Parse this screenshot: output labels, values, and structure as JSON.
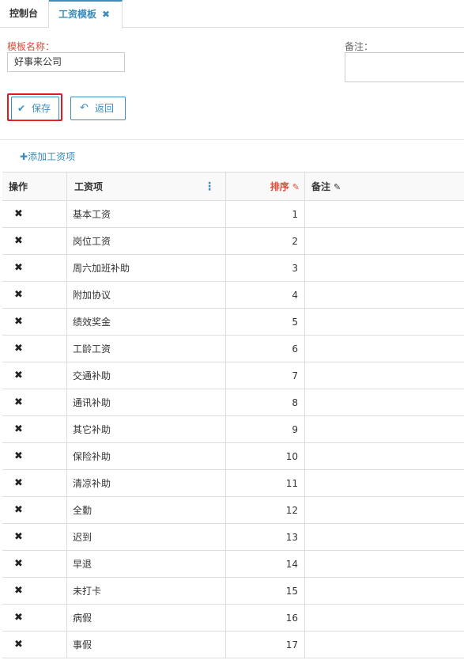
{
  "tabs": [
    {
      "label": "控制台"
    },
    {
      "label": "工资模板",
      "close": "✖"
    }
  ],
  "form": {
    "name_label": "模板名称：",
    "name_value": "好事来公司",
    "remark_label": "备注：",
    "remark_value": ""
  },
  "buttons": {
    "save_label": "保存",
    "back_label": "返回"
  },
  "add_link": {
    "plus": "✚",
    "label": "添加工资项"
  },
  "table": {
    "headers": {
      "op": "操作",
      "item": "工资项",
      "order": "排序",
      "remark": "备注"
    },
    "rows": [
      {
        "name": "基本工资",
        "order": "1"
      },
      {
        "name": "岗位工资",
        "order": "2"
      },
      {
        "name": "周六加班补助",
        "order": "3"
      },
      {
        "name": "附加协议",
        "order": "4"
      },
      {
        "name": "绩效奖金",
        "order": "5"
      },
      {
        "name": "工龄工资",
        "order": "6"
      },
      {
        "name": "交通补助",
        "order": "7"
      },
      {
        "name": "通讯补助",
        "order": "8"
      },
      {
        "name": "其它补助",
        "order": "9"
      },
      {
        "name": "保险补助",
        "order": "10"
      },
      {
        "name": "清凉补助",
        "order": "11"
      },
      {
        "name": "全勤",
        "order": "12"
      },
      {
        "name": "迟到",
        "order": "13"
      },
      {
        "name": "早退",
        "order": "14"
      },
      {
        "name": "未打卡",
        "order": "15"
      },
      {
        "name": "病假",
        "order": "16"
      },
      {
        "name": "事假",
        "order": "17"
      }
    ]
  },
  "icons": {
    "tab_close": "close-icon",
    "save": "check-icon",
    "back": "undo-icon",
    "add": "plus-icon",
    "column_menu": "kebab-menu-icon",
    "edit": "edit-icon",
    "delete_row": "delete-icon"
  },
  "colors": {
    "accent": "#3c8dbc",
    "required_label": "#dd4b39",
    "highlight_outline": "#e01b1b"
  }
}
